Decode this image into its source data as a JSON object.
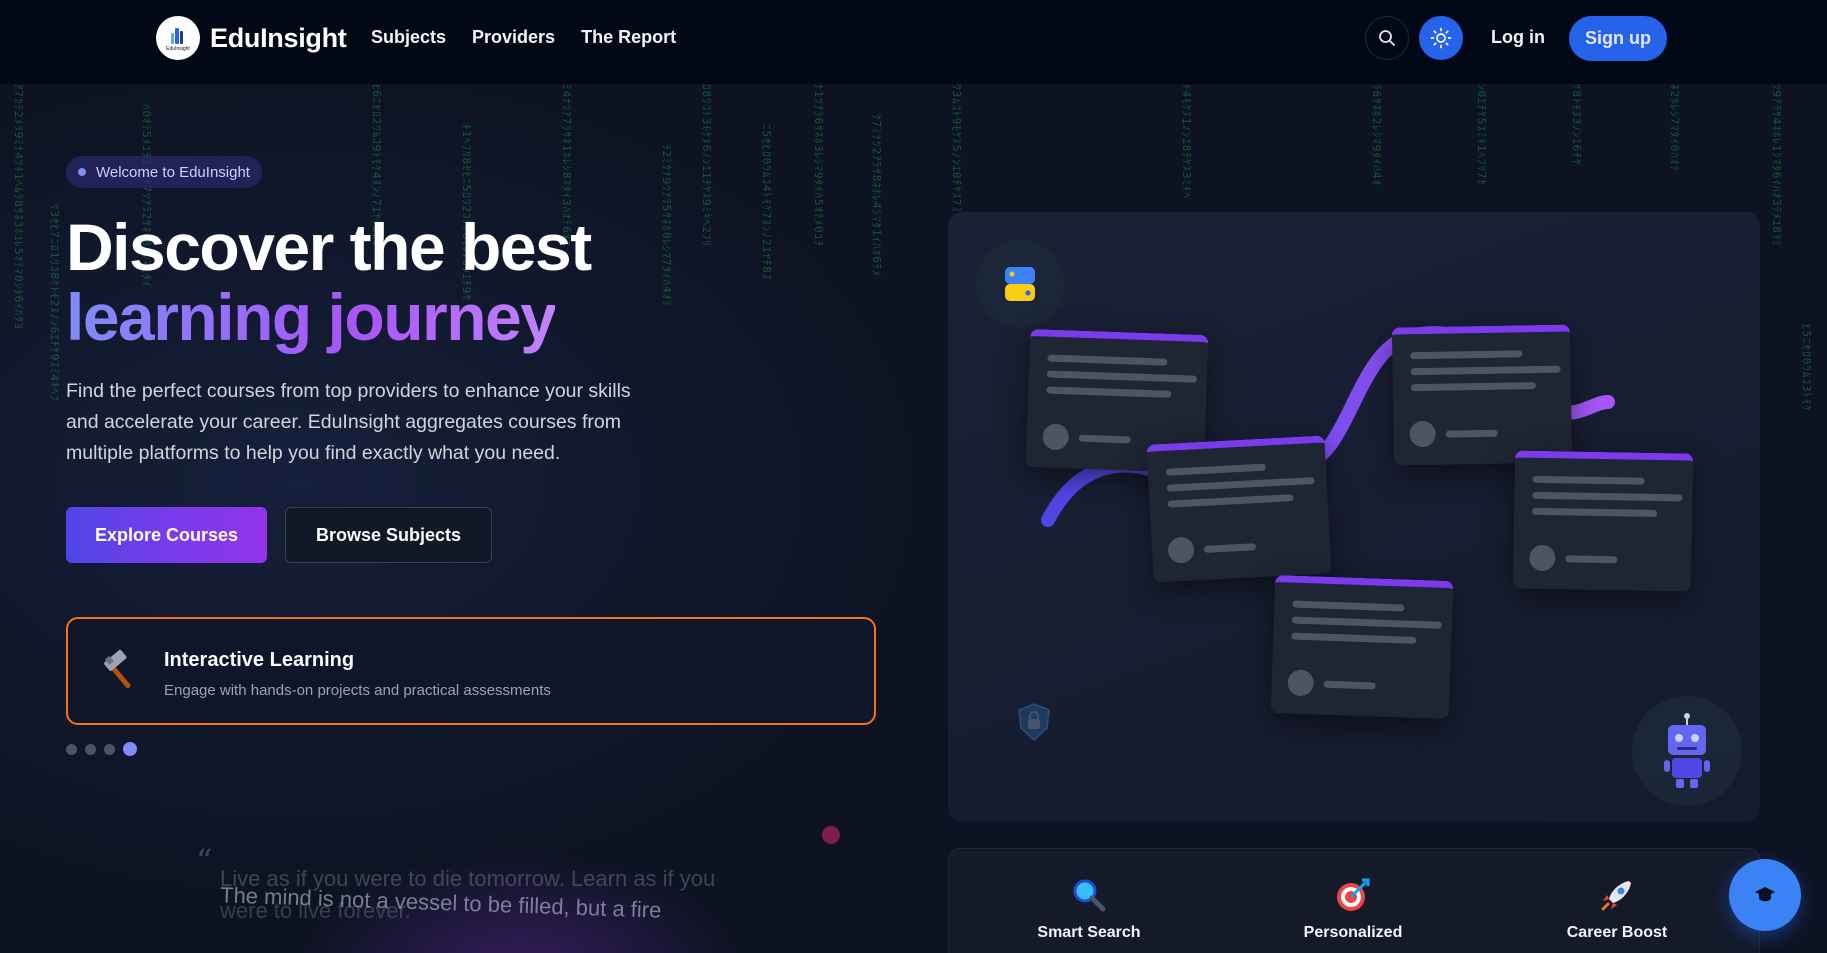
{
  "brand": {
    "name": "EduInsight",
    "logo_text": "EduInsight"
  },
  "nav": {
    "links": [
      "Subjects",
      "Providers",
      "The Report"
    ],
    "login": "Log in",
    "signup": "Sign up"
  },
  "hero": {
    "badge": "Welcome to EduInsight",
    "title_line1": "Discover the best",
    "title_line2": "learning journey",
    "lead": "Find the perfect courses from top providers to enhance your skills and accelerate your career. EduInsight aggregates courses from multiple platforms to help you find exactly what you need.",
    "primary_button": "Explore Courses",
    "secondary_button": "Browse Subjects",
    "feature": {
      "icon": "hammer-icon",
      "title": "Interactive Learning",
      "description": "Engage with hands-on projects and practical assessments"
    },
    "carousel": {
      "count": 4,
      "active_index": 3
    }
  },
  "quotes": {
    "quote_a_line1": "Live as if you were to die tomorrow. Learn as if you",
    "quote_a_line2": "were to live forever.",
    "quote_b": "The mind is not a vessel to be filled, but a fire"
  },
  "stats": [
    {
      "icon": "magnifier-icon",
      "label": "Smart Search"
    },
    {
      "icon": "target-icon",
      "label": "Personalized"
    },
    {
      "icon": "rocket-icon",
      "label": "Career Boost"
    }
  ],
  "colors": {
    "accent": "#2563eb",
    "brand_purple": "#7c3aed",
    "highlight_border": "#f97316",
    "background": "#0b1120"
  }
}
